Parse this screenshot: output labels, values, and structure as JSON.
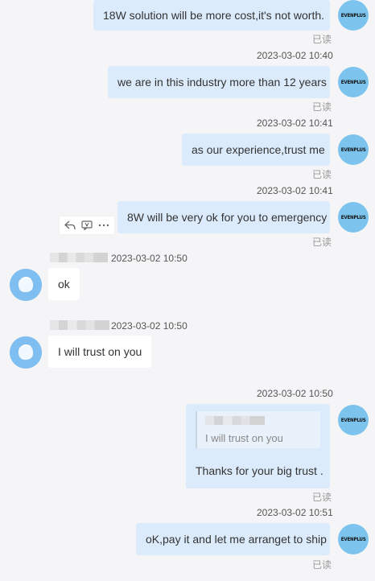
{
  "self_avatar_text": "EVENPLUS",
  "read_label": "已读",
  "messages": {
    "m1": {
      "text": "18W solution will be more cost,it's not worth."
    },
    "m2": {
      "time": "2023-03-02 10:40",
      "text": "we are in this industry more than 12 years"
    },
    "m3": {
      "time": "2023-03-02 10:41",
      "text": "as our experience,trust me"
    },
    "m4": {
      "time": "2023-03-02 10:41",
      "text": "8W will be very ok for you to emergency"
    },
    "m5": {
      "time": "2023-03-02 10:50",
      "text": "ok"
    },
    "m6": {
      "time": "2023-03-02 10:50",
      "text": "I will trust on you"
    },
    "m7": {
      "time": "2023-03-02 10:50",
      "quote_text": "I will trust on you",
      "text": "Thanks for your big trust ."
    },
    "m8": {
      "time": "2023-03-02 10:51",
      "text": "oK,pay it and let me arranget to ship"
    }
  },
  "toolbar": {
    "reply_icon": "reply-icon",
    "translate_icon": "translate-icon",
    "more_icon": "more-icon"
  },
  "colors": {
    "out_bubble": "#dcebfb",
    "in_bubble": "#ffffff",
    "avatar_blue": "#7cc4ee",
    "background": "#f5f5f7"
  }
}
